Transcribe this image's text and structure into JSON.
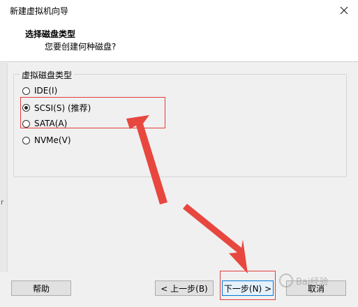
{
  "window": {
    "title": "新建虚拟机向导",
    "close_icon": "close-icon"
  },
  "header": {
    "title": "选择磁盘类型",
    "subtitle": "您要创建何种磁盘?"
  },
  "left_strip": {
    "glyph": "r"
  },
  "disk_type_group": {
    "legend": "虚拟磁盘类型",
    "options": [
      {
        "label": "IDE(I)",
        "checked": false
      },
      {
        "label": "SCSI(S) (推荐)",
        "checked": true
      },
      {
        "label": "SATA(A)",
        "checked": false
      },
      {
        "label": "NVMe(V)",
        "checked": false
      }
    ]
  },
  "buttons": {
    "help": "帮助",
    "back": "< 上一步(B)",
    "next": "下一步(N) >",
    "cancel": "取消"
  },
  "watermark": {
    "text": "Bai经验"
  },
  "colors": {
    "annotation_red": "#e23b3b",
    "dialog_bg": "#f0f0f0",
    "focus_blue": "#0078d7"
  }
}
